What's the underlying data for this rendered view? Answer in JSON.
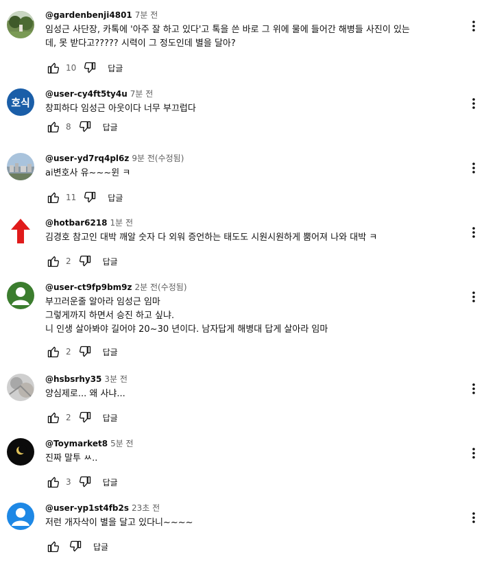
{
  "reply_label": "답글",
  "comments": [
    {
      "author": "@gardenbenji4801",
      "time": "7분 전",
      "text": "임성근 사단장, 카톡에 '아주 잘 하고 있다'고 톡을 쓴 바로 그 위에 물에 들어간 해병들 사진이 있는\n데, 못 받다고????? 시력이 그 정도인데 별을 달아?",
      "likes": "10",
      "avatar": "photo-green"
    },
    {
      "author": "@user-cy4ft5ty4u",
      "time": "7분 전",
      "text": "창피하다 임성근 아웃이다 너무 부끄럽다",
      "likes": "8",
      "avatar": "text",
      "avatar_text": "호식",
      "avatar_color": "#1a5ea8"
    },
    {
      "author": "@user-yd7rq4pl6z",
      "time": "9분 전(수정됨)",
      "text": "ai변호사 유~~~윈 ㅋ",
      "likes": "11",
      "avatar": "photo-city"
    },
    {
      "author": "@hotbar6218",
      "time": "1분 전",
      "text": "김경호 참고인 대박  깨알 숫자 다 외워 증언하는 태도도 시원시원하게 뿜어져 나와 대박 ㅋ",
      "likes": "2",
      "avatar": "red-arrow"
    },
    {
      "author": "@user-ct9fp9bm9z",
      "time": "2분 전(수정됨)",
      "text": "부끄러운줄 알아라 임성근 임마\n그렇게까지 하면서 승진 하고 싶냐.\n니 인생 살아봐야 길어야 20~30 년이다. 남자답게 해병대 답게 살아라 임마",
      "likes": "2",
      "avatar": "default",
      "avatar_color": "#3b7d2e"
    },
    {
      "author": "@hsbsrhy35",
      "time": "3분 전",
      "text": "양심제로... 왜 사냐...",
      "likes": "2",
      "avatar": "photo-grey"
    },
    {
      "author": "@Toymarket8",
      "time": "5분 전",
      "text": "진짜 말투 ㅆ..",
      "likes": "3",
      "avatar": "moon"
    },
    {
      "author": "@user-yp1st4fb2s",
      "time": "23초 전",
      "text": "저런 개자삭이  별을 달고 있다니~~~~",
      "likes": "",
      "avatar": "default",
      "avatar_color": "#1e88e5"
    }
  ],
  "icons": {
    "like": "thumb-up-icon",
    "dislike": "thumb-down-icon",
    "menu": "more-vert-icon"
  }
}
